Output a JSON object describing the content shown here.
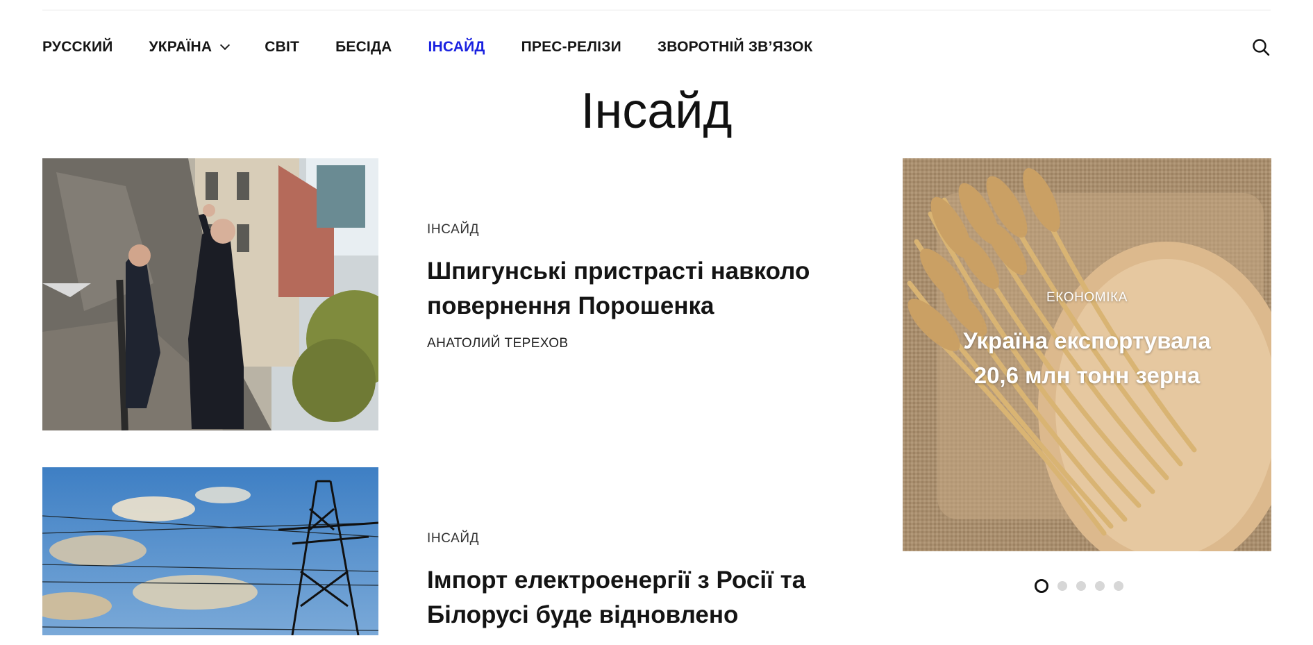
{
  "nav": {
    "items": [
      {
        "label": "РУССКИЙ"
      },
      {
        "label": "УКРАЇНА"
      },
      {
        "label": "СВІТ"
      },
      {
        "label": "БЕСІДА"
      },
      {
        "label": "ІНСАЙД"
      },
      {
        "label": "ПРЕС-РЕЛІЗИ"
      },
      {
        "label": "ЗВОРОТНІЙ ЗВ’ЯЗОК"
      }
    ],
    "active_label": "ІНСАЙД",
    "active_color": "#1a22e0",
    "dropdown_icon": "chevron-down-icon",
    "search_icon": "search-icon"
  },
  "page": {
    "title": "Інсайд"
  },
  "posts": [
    {
      "category": "ІНСАЙД",
      "title": "Шпигунські пристрасті навколо повернення Порошенка",
      "author": "АНАТОЛИЙ ТЕРЕХОВ"
    },
    {
      "category": "ІНСАЙД",
      "title": "Імпорт електроенергії з Росії та Білорусі буде відновлено"
    }
  ],
  "slider": {
    "category": "ЕКОНОМІКА",
    "title": "Україна експортувала 20,6 млн тонн зерна",
    "dot_count": 5,
    "active_dot": 1
  }
}
